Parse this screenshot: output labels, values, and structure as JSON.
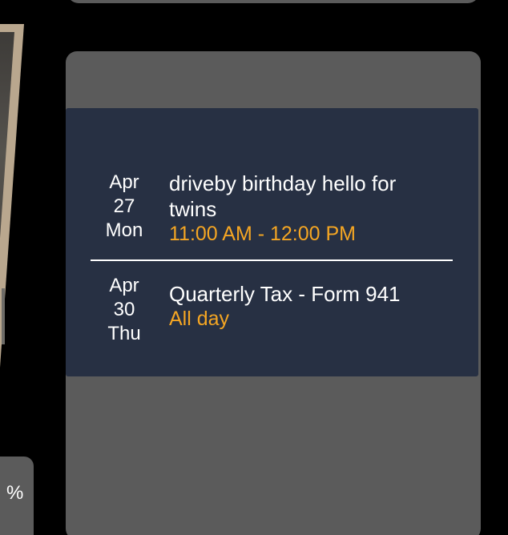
{
  "tile": {
    "percent_symbol": "%"
  },
  "events": [
    {
      "month": "Apr",
      "day": "27",
      "weekday": "Mon",
      "title": "driveby birthday hello for twins",
      "time": "11:00 AM - 12:00 PM"
    },
    {
      "month": "Apr",
      "day": "30",
      "weekday": "Thu",
      "title": "Quarterly Tax - Form 941",
      "time": "All day"
    }
  ],
  "colors": {
    "background": "#000000",
    "widget_bg": "#5b5b5b",
    "panel_bg": "#273043",
    "text": "#ffffff",
    "time_accent": "#f5a623"
  }
}
